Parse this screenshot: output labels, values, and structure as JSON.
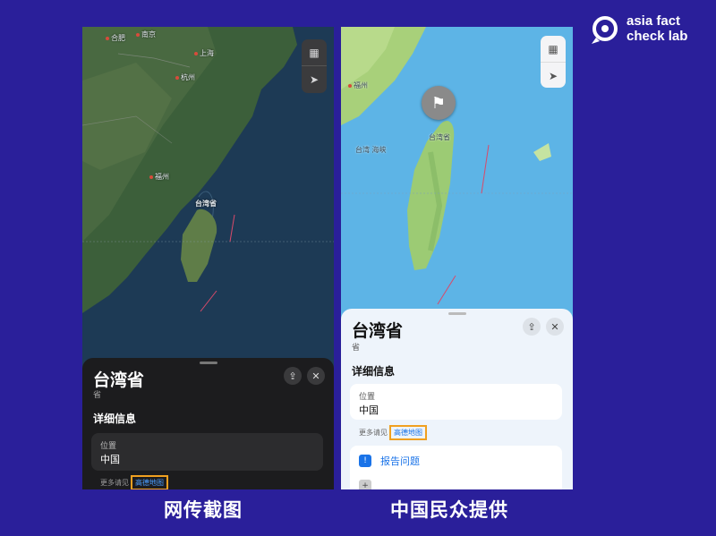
{
  "logo": {
    "text": "asia fact\ncheck lab",
    "icon": "magnifier-logo-icon"
  },
  "left_phone": {
    "map_labels": {
      "hefei": "合肥",
      "nanjing": "南京",
      "shanghai": "上海",
      "hangzhou": "杭州",
      "fuzhou": "福州",
      "taiwan": "台湾省"
    },
    "controls": [
      "map-icon",
      "location-arrow-icon"
    ],
    "sheet": {
      "title": "台湾省",
      "subtitle": "省",
      "section": "详细信息",
      "card_label": "位置",
      "card_value": "中国",
      "more_prefix": "更多请见",
      "more_link": "高德地图"
    }
  },
  "right_phone": {
    "map_labels": {
      "fuzhou": "福州",
      "strait": "台湾 海峡",
      "taiwan": "台湾省"
    },
    "controls": [
      "map-icon",
      "location-arrow-icon"
    ],
    "sheet": {
      "title": "台湾省",
      "subtitle": "省",
      "section": "详细信息",
      "card_label": "位置",
      "card_value": "中国",
      "more_prefix": "更多请见",
      "more_link": "高德地图",
      "action_1": "报告问题"
    }
  },
  "captions": {
    "left": "网传截图",
    "right": "中国民众提供"
  },
  "colors": {
    "background": "#2a1f9a",
    "highlight_box": "#f0a020",
    "link": "#4a9dff"
  }
}
